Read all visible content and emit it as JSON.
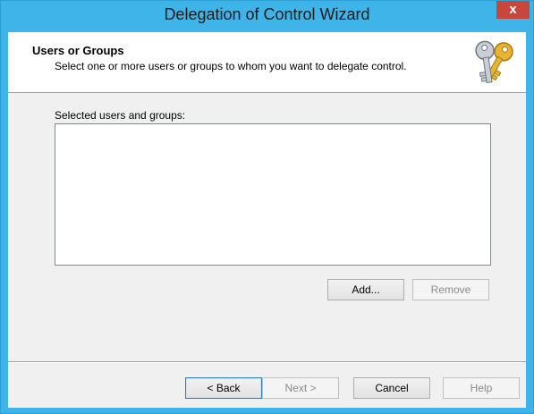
{
  "window": {
    "title": "Delegation of Control Wizard",
    "close_label": "x"
  },
  "header": {
    "title": "Users or Groups",
    "description": "Select one or more users or groups to whom you want to delegate control.",
    "icon": "keys-icon"
  },
  "main": {
    "list_label": "Selected users and groups:",
    "items": [],
    "add_label": "Add...",
    "remove_label": "Remove"
  },
  "footer": {
    "back_label": "< Back",
    "next_label": "Next >",
    "cancel_label": "Cancel",
    "help_label": "Help"
  },
  "colors": {
    "title_bar": "#3fb4e8",
    "close_button": "#c9463d"
  }
}
